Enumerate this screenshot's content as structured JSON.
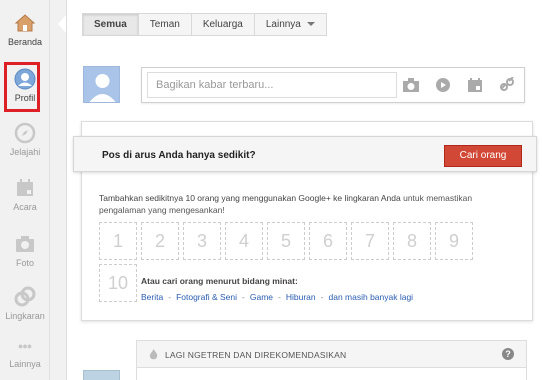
{
  "sidebar": {
    "items": [
      {
        "label": "Beranda",
        "icon": "home-icon"
      },
      {
        "label": "Profil",
        "icon": "profile-icon"
      },
      {
        "label": "Jelajahi",
        "icon": "compass-icon"
      },
      {
        "label": "Acara",
        "icon": "calendar-icon"
      },
      {
        "label": "Foto",
        "icon": "camera-icon"
      },
      {
        "label": "Lingkaran",
        "icon": "circles-icon"
      },
      {
        "label": "Lainnya",
        "icon": "more-icon"
      }
    ],
    "highlight_color": "#dd1f26"
  },
  "tabs": [
    "Semua",
    "Teman",
    "Keluarga",
    "Lainnya"
  ],
  "share": {
    "placeholder": "Bagikan kabar terbaru...",
    "icons": [
      "camera-icon",
      "video-icon",
      "event-icon",
      "link-icon"
    ]
  },
  "banner": {
    "title": "Pos di arus Anda hanya sedikit?",
    "button": "Cari orang",
    "button_color": "#d14836"
  },
  "suggest": {
    "text_before": "Tambahkan sedikitnya 10 orang yang menggunakan Google+ ke lingkaran Anda",
    "text_after": " untuk memastikan pengalaman yang mengesankan!",
    "slots": [
      "1",
      "2",
      "3",
      "4",
      "5",
      "6",
      "7",
      "8",
      "9",
      "10"
    ],
    "find_title": "Atau cari orang menurut bidang minat:",
    "links": [
      "Berita",
      "Fotografi & Seni",
      "Game",
      "Hiburan",
      "dan masih banyak lagi"
    ]
  },
  "trending": {
    "title": "LAGI NGETREN DAN DIREKOMENDASIKAN",
    "help": "?"
  }
}
